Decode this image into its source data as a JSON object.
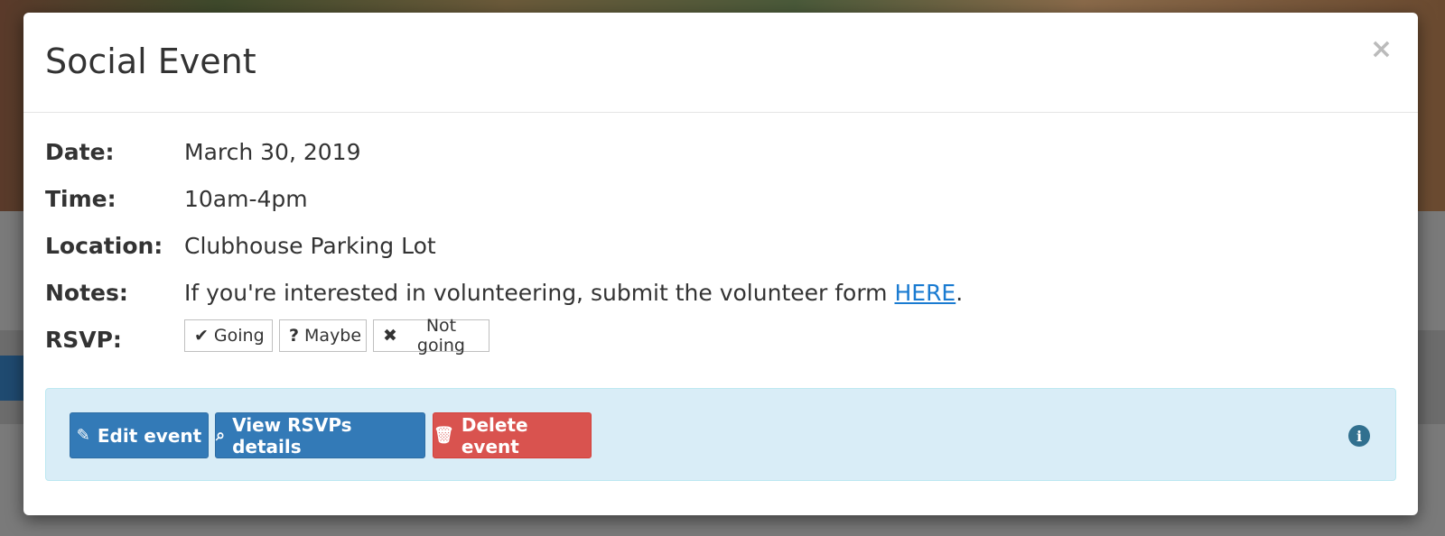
{
  "modal": {
    "title": "Social Event",
    "close_label": "×"
  },
  "details": {
    "date_label": "Date:",
    "date_value": "March 30, 2019",
    "time_label": "Time:",
    "time_value": "10am-4pm",
    "location_label": "Location:",
    "location_value": "Clubhouse Parking Lot",
    "notes_label": "Notes:",
    "notes_text": "If you're interested in volunteering, submit the volunteer form ",
    "notes_link": "HERE",
    "notes_end": ".",
    "rsvp_label": "RSVP:"
  },
  "rsvp": {
    "going": "Going",
    "maybe": "Maybe",
    "not_going": "Not going",
    "going_icon": "✔",
    "maybe_icon": "?",
    "not_going_icon": "✖"
  },
  "actions": {
    "edit": "Edit event",
    "view": "View RSVPs details",
    "delete": "Delete event",
    "edit_icon": "✎",
    "view_icon": "⌕",
    "delete_icon": "🗑",
    "info_icon": "i"
  },
  "colors": {
    "primary": "#337ab7",
    "danger": "#d9534f",
    "info_bg": "#d9edf7",
    "link": "#1a7bd1"
  }
}
